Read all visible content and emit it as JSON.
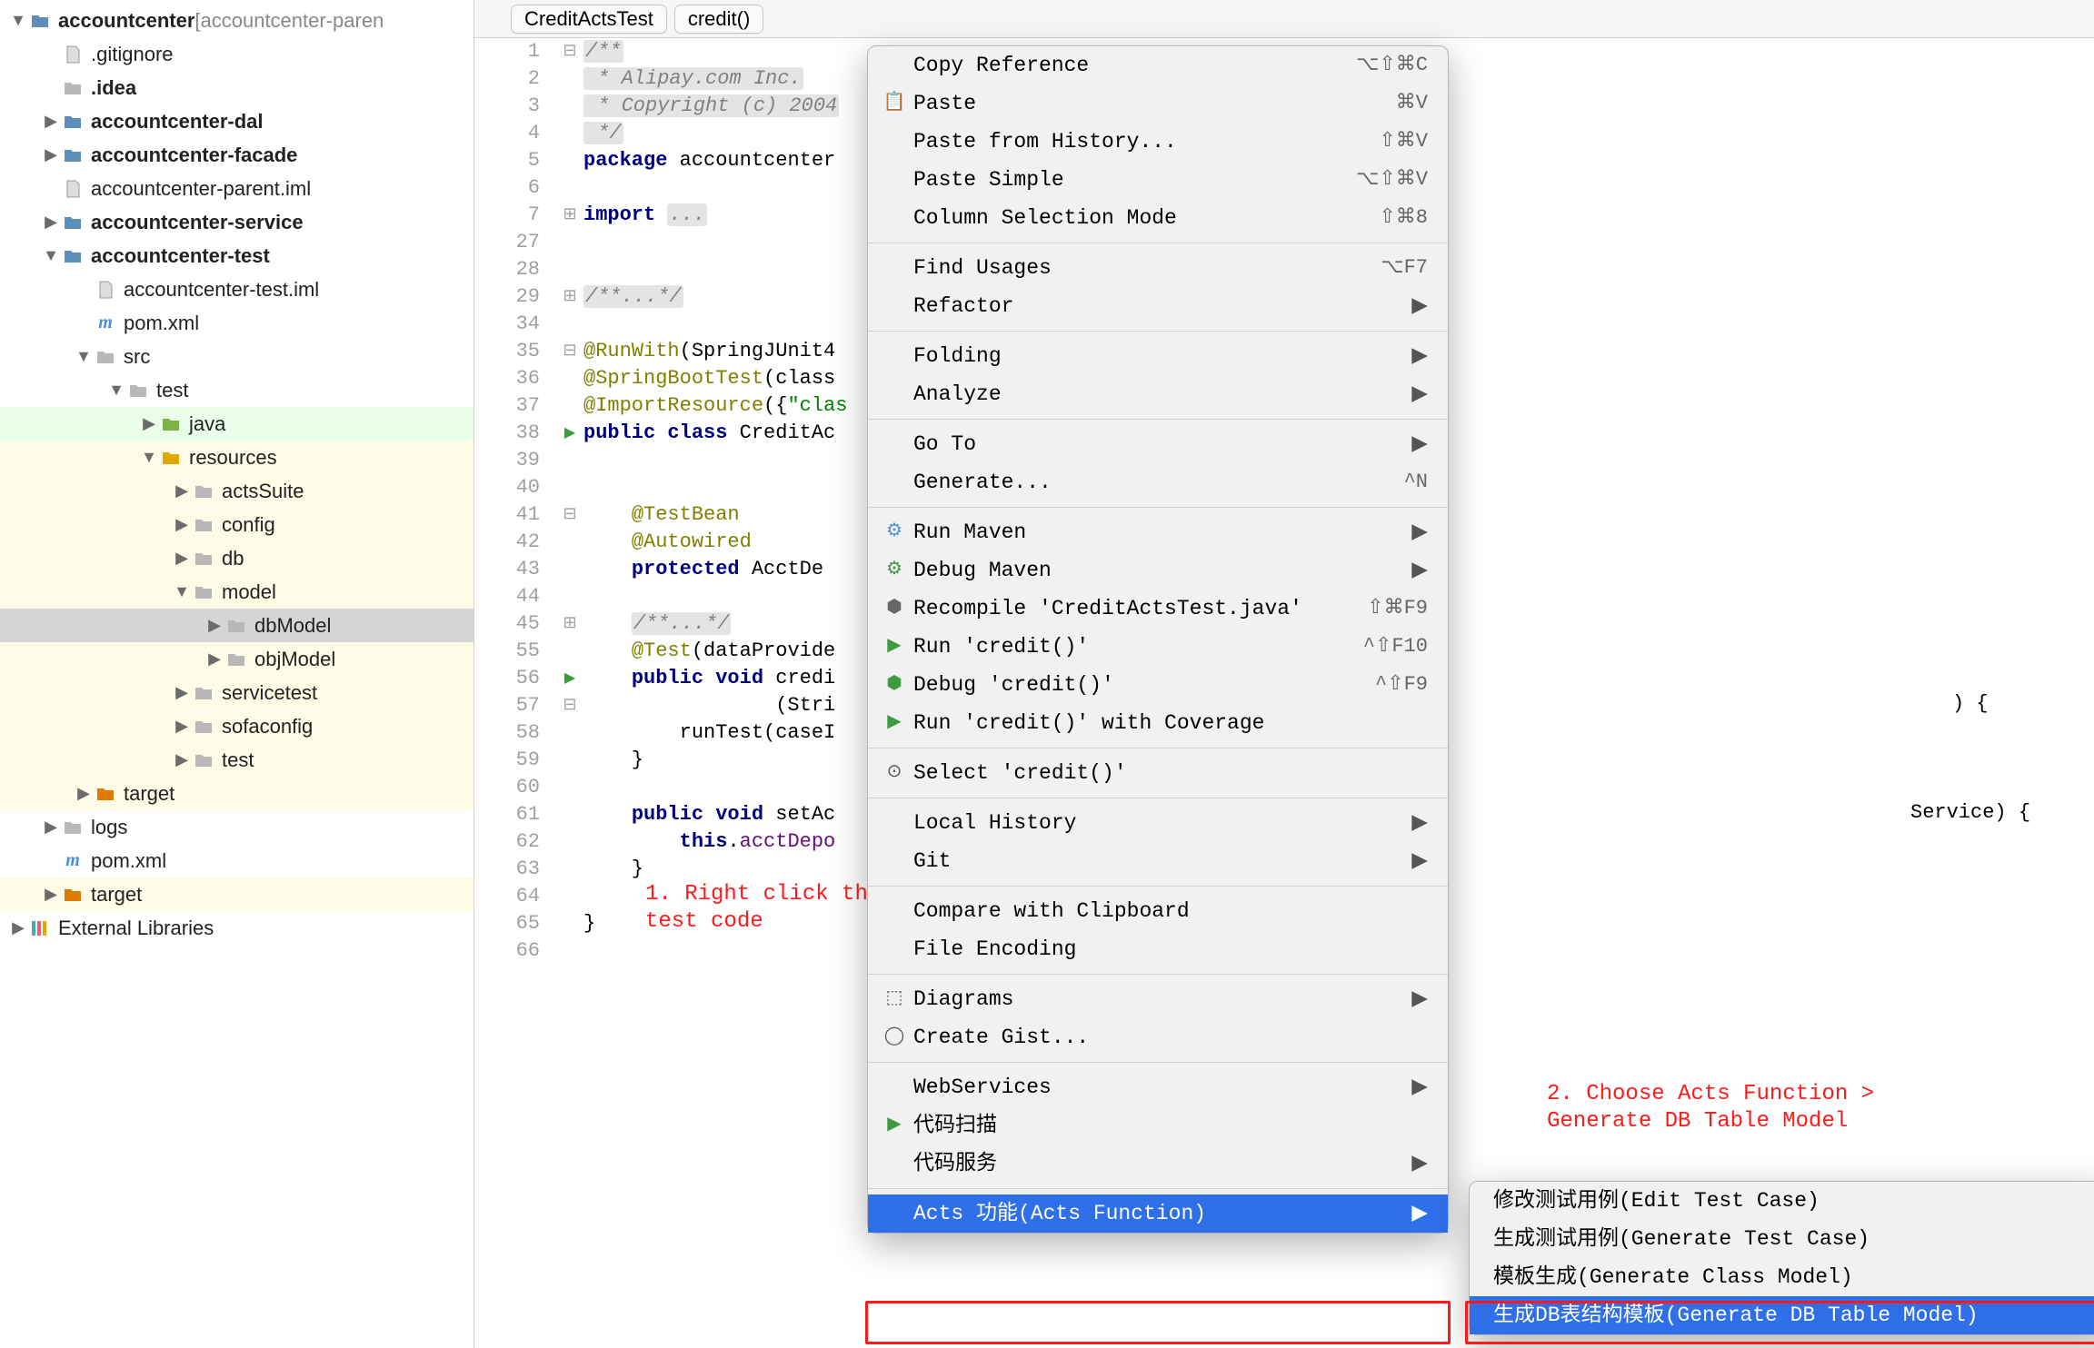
{
  "breadcrumb": {
    "class_name": "CreditActsTest",
    "method_name": "credit()"
  },
  "tree": [
    {
      "indent": 0,
      "arrow": "down",
      "icon": "module",
      "label": "accountcenter",
      "suffix": " [accountcenter-paren",
      "bold": true
    },
    {
      "indent": 1,
      "arrow": "blank",
      "icon": "file",
      "label": ".gitignore"
    },
    {
      "indent": 1,
      "arrow": "blank",
      "icon": "folder",
      "label": ".idea",
      "bold": true
    },
    {
      "indent": 1,
      "arrow": "right",
      "icon": "module",
      "label": "accountcenter-dal",
      "bold": true
    },
    {
      "indent": 1,
      "arrow": "right",
      "icon": "module",
      "label": "accountcenter-facade",
      "bold": true
    },
    {
      "indent": 1,
      "arrow": "blank",
      "icon": "file",
      "label": "accountcenter-parent.iml"
    },
    {
      "indent": 1,
      "arrow": "right",
      "icon": "module",
      "label": "accountcenter-service",
      "bold": true
    },
    {
      "indent": 1,
      "arrow": "down",
      "icon": "module",
      "label": "accountcenter-test",
      "bold": true
    },
    {
      "indent": 2,
      "arrow": "blank",
      "icon": "file",
      "label": "accountcenter-test.iml"
    },
    {
      "indent": 2,
      "arrow": "blank",
      "icon": "maven",
      "label": "pom.xml"
    },
    {
      "indent": 2,
      "arrow": "down",
      "icon": "folder",
      "label": "src"
    },
    {
      "indent": 3,
      "arrow": "down",
      "icon": "folder",
      "label": "test"
    },
    {
      "indent": 4,
      "arrow": "right",
      "icon": "src-green",
      "label": "java",
      "hl": "green"
    },
    {
      "indent": 4,
      "arrow": "down",
      "icon": "res",
      "label": "resources",
      "hl": "yellow"
    },
    {
      "indent": 5,
      "arrow": "right",
      "icon": "folder",
      "label": "actsSuite",
      "hl": "yellow"
    },
    {
      "indent": 5,
      "arrow": "right",
      "icon": "folder",
      "label": "config",
      "hl": "yellow"
    },
    {
      "indent": 5,
      "arrow": "right",
      "icon": "folder",
      "label": "db",
      "hl": "yellow"
    },
    {
      "indent": 5,
      "arrow": "down",
      "icon": "folder",
      "label": "model",
      "hl": "yellow"
    },
    {
      "indent": 6,
      "arrow": "right",
      "icon": "folder",
      "label": "dbModel",
      "selected": true
    },
    {
      "indent": 6,
      "arrow": "right",
      "icon": "folder",
      "label": "objModel",
      "hl": "yellow"
    },
    {
      "indent": 5,
      "arrow": "right",
      "icon": "folder",
      "label": "servicetest",
      "hl": "yellow"
    },
    {
      "indent": 5,
      "arrow": "right",
      "icon": "folder",
      "label": "sofaconfig",
      "hl": "yellow"
    },
    {
      "indent": 5,
      "arrow": "right",
      "icon": "folder",
      "label": "test",
      "hl": "yellow"
    },
    {
      "indent": 2,
      "arrow": "right",
      "icon": "target",
      "label": "target",
      "hl": "yellow"
    },
    {
      "indent": 1,
      "arrow": "right",
      "icon": "folder",
      "label": "logs"
    },
    {
      "indent": 1,
      "arrow": "blank",
      "icon": "maven",
      "label": "pom.xml"
    },
    {
      "indent": 1,
      "arrow": "right",
      "icon": "target",
      "label": "target",
      "hl": "yellow"
    },
    {
      "indent": 0,
      "arrow": "right",
      "icon": "lib",
      "label": "External Libraries"
    }
  ],
  "code": [
    {
      "n": "1",
      "fold": "-",
      "html": "<span class='c-comment'>/**</span>"
    },
    {
      "n": "2",
      "html": "<span class='c-comment'> * Alipay.com Inc.</span>"
    },
    {
      "n": "3",
      "html": "<span class='c-comment'> * Copyright (c) 2004</span>"
    },
    {
      "n": "4",
      "html": "<span class='c-comment'> */</span>"
    },
    {
      "n": "5",
      "html": "<span class='c-keyword'>package</span> accountcenter"
    },
    {
      "n": "6",
      "html": ""
    },
    {
      "n": "7",
      "fold": "+",
      "html": "<span class='c-keyword'>import </span><span class='c-comment'>...</span>"
    },
    {
      "n": "27",
      "html": ""
    },
    {
      "n": "28",
      "html": ""
    },
    {
      "n": "29",
      "fold": "+",
      "html": "<span class='c-comment'>/**...*/</span>"
    },
    {
      "n": "34",
      "html": ""
    },
    {
      "n": "35",
      "fold": "-",
      "html": "<span class='c-annotation'>@RunWith</span>(SpringJUnit4"
    },
    {
      "n": "36",
      "html": "<span class='c-annotation'>@SpringBootTest</span>(class"
    },
    {
      "n": "37",
      "html": "<span class='c-annotation'>@ImportResource</span>({<span class='c-string'>\"clas</span>"
    },
    {
      "n": "38",
      "run": true,
      "html": "<span class='c-keyword'>public class</span> CreditAc"
    },
    {
      "n": "39",
      "html": ""
    },
    {
      "n": "40",
      "html": ""
    },
    {
      "n": "41",
      "fold": "-",
      "html": "    <span class='c-annotation'>@TestBean</span>"
    },
    {
      "n": "42",
      "html": "    <span class='c-annotation'>@Autowired</span>"
    },
    {
      "n": "43",
      "html": "    <span class='c-keyword'>protected</span> AcctDe"
    },
    {
      "n": "44",
      "html": ""
    },
    {
      "n": "45",
      "fold": "+",
      "html": "    <span class='c-comment'>/**...*/</span>"
    },
    {
      "n": "55",
      "html": "    <span class='c-annotation'>@Test</span>(dataProvide"
    },
    {
      "n": "56",
      "run": true,
      "html": "    <span class='c-keyword'>public void</span> <span class='c-method'>credi</span>"
    },
    {
      "n": "57",
      "fold": "-",
      "html": "                (Stri"
    },
    {
      "n": "58",
      "html": "        runTest(caseI"
    },
    {
      "n": "59",
      "html": "    }"
    },
    {
      "n": "60",
      "html": ""
    },
    {
      "n": "61",
      "html": "    <span class='c-keyword'>public void</span> setAc"
    },
    {
      "n": "62",
      "html": "        <span class='c-keyword'>this</span>.<span class='c-field'>acctDepo</span>"
    },
    {
      "n": "63",
      "html": "    }"
    },
    {
      "n": "64",
      "html": ""
    },
    {
      "n": "65",
      "html": "}"
    },
    {
      "n": "66",
      "html": ""
    }
  ],
  "menu": [
    {
      "type": "item",
      "icon": "",
      "label": "Copy Reference",
      "short": "⌥⇧⌘C"
    },
    {
      "type": "item",
      "icon": "📋",
      "label": "Paste",
      "short": "⌘V"
    },
    {
      "type": "item",
      "icon": "",
      "label": "Paste from History...",
      "short": "⇧⌘V"
    },
    {
      "type": "item",
      "icon": "",
      "label": "Paste Simple",
      "short": "⌥⇧⌘V"
    },
    {
      "type": "item",
      "icon": "",
      "label": "Column Selection Mode",
      "short": "⇧⌘8"
    },
    {
      "type": "sep"
    },
    {
      "type": "item",
      "icon": "",
      "label": "Find Usages",
      "short": "⌥F7"
    },
    {
      "type": "item",
      "icon": "",
      "label": "Refactor",
      "arrow": true
    },
    {
      "type": "sep"
    },
    {
      "type": "item",
      "icon": "",
      "label": "Folding",
      "arrow": true
    },
    {
      "type": "item",
      "icon": "",
      "label": "Analyze",
      "arrow": true
    },
    {
      "type": "sep"
    },
    {
      "type": "item",
      "icon": "",
      "label": "Go To",
      "arrow": true
    },
    {
      "type": "item",
      "icon": "",
      "label": "Generate...",
      "short": "^N"
    },
    {
      "type": "sep"
    },
    {
      "type": "item",
      "icon": "⚙",
      "iconcolor": "#4a90d9",
      "label": "Run Maven",
      "arrow": true
    },
    {
      "type": "item",
      "icon": "⚙",
      "iconcolor": "#3c9b3c",
      "label": "Debug Maven",
      "arrow": true
    },
    {
      "type": "item",
      "icon": "⬢",
      "iconcolor": "#666",
      "label": "Recompile 'CreditActsTest.java'",
      "short": "⇧⌘F9"
    },
    {
      "type": "item",
      "icon": "▶",
      "iconcolor": "#3c9b3c",
      "label": "Run 'credit()'",
      "short": "^⇧F10"
    },
    {
      "type": "item",
      "icon": "⬢",
      "iconcolor": "#3c9b3c",
      "label": "Debug 'credit()'",
      "short": "^⇧F9"
    },
    {
      "type": "item",
      "icon": "▶",
      "iconcolor": "#3c9b3c",
      "label": "Run 'credit()' with Coverage"
    },
    {
      "type": "sep"
    },
    {
      "type": "item",
      "icon": "⊙",
      "label": "Select 'credit()'"
    },
    {
      "type": "sep"
    },
    {
      "type": "item",
      "icon": "",
      "label": "Local History",
      "arrow": true
    },
    {
      "type": "item",
      "icon": "",
      "label": "Git",
      "arrow": true
    },
    {
      "type": "sep"
    },
    {
      "type": "item",
      "icon": "",
      "label": "Compare with Clipboard"
    },
    {
      "type": "item",
      "icon": "",
      "label": "File Encoding"
    },
    {
      "type": "sep"
    },
    {
      "type": "item",
      "icon": "⬚",
      "label": "Diagrams",
      "arrow": true
    },
    {
      "type": "item",
      "icon": "◯",
      "label": "Create Gist..."
    },
    {
      "type": "sep"
    },
    {
      "type": "item",
      "icon": "",
      "label": "WebServices",
      "arrow": true
    },
    {
      "type": "item",
      "icon": "▶",
      "iconcolor": "#3c9b3c",
      "label": "代码扫描"
    },
    {
      "type": "item",
      "icon": "",
      "label": "代码服务",
      "arrow": true
    },
    {
      "type": "sep"
    },
    {
      "type": "item",
      "icon": "",
      "label": "Acts 功能(Acts Function)",
      "arrow": true,
      "highlight": true
    }
  ],
  "submenu": [
    {
      "label": "修改测试用例(Edit Test Case)"
    },
    {
      "label": "生成测试用例(Generate Test Case)"
    },
    {
      "label": "模板生成(Generate Class Model)"
    },
    {
      "label": "生成DB表结构模板(Generate DB Table Model)",
      "highlight": true
    }
  ],
  "annotations": {
    "a1_line1": "1. Right click the",
    "a1_line2": "   test code",
    "a2_line1": "2. Choose Acts Function >",
    "a2_line2": "    Generate DB Table Model"
  },
  "code_tail": {
    "l57": ") {",
    "l61": "Service) {"
  }
}
